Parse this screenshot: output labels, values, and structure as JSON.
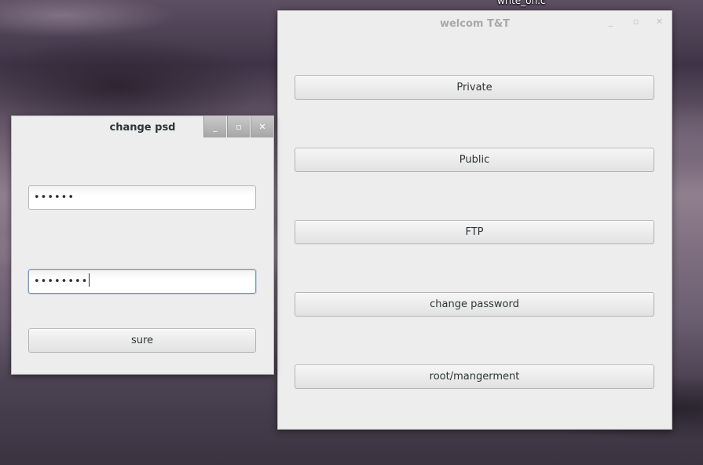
{
  "desktop": {
    "file_label": "write_on.c"
  },
  "main_window": {
    "title": "welcom T&T",
    "controls": {
      "minimize": "_",
      "maximize": "▫",
      "close": "✕"
    },
    "buttons": [
      "Private",
      "Public",
      "FTP",
      "change password",
      "root/mangerment"
    ]
  },
  "password_window": {
    "title": "change psd",
    "controls": {
      "minimize": "_",
      "maximize": "▫",
      "close": "✕"
    },
    "field1_value": "••••••",
    "field2_value": "••••••••",
    "submit_label": "sure"
  }
}
